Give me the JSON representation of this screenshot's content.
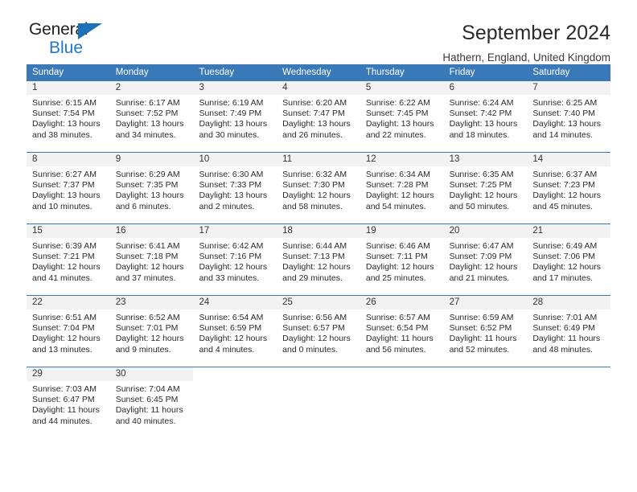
{
  "brand": {
    "name_top": "General",
    "name_bottom": "Blue",
    "triangle_color": "#1b72b8",
    "text_color": "#231f20",
    "blue_color": "#2277c8"
  },
  "header": {
    "title": "September 2024",
    "subtitle": "Hathern, England, United Kingdom"
  },
  "calendar": {
    "header_bg": "#3a79b8",
    "daynum_bg": "#f2f2f2",
    "weekdays": [
      "Sunday",
      "Monday",
      "Tuesday",
      "Wednesday",
      "Thursday",
      "Friday",
      "Saturday"
    ],
    "weeks": [
      [
        {
          "day": "1",
          "sunrise": "Sunrise: 6:15 AM",
          "sunset": "Sunset: 7:54 PM",
          "daylight1": "Daylight: 13 hours",
          "daylight2": "and 38 minutes."
        },
        {
          "day": "2",
          "sunrise": "Sunrise: 6:17 AM",
          "sunset": "Sunset: 7:52 PM",
          "daylight1": "Daylight: 13 hours",
          "daylight2": "and 34 minutes."
        },
        {
          "day": "3",
          "sunrise": "Sunrise: 6:19 AM",
          "sunset": "Sunset: 7:49 PM",
          "daylight1": "Daylight: 13 hours",
          "daylight2": "and 30 minutes."
        },
        {
          "day": "4",
          "sunrise": "Sunrise: 6:20 AM",
          "sunset": "Sunset: 7:47 PM",
          "daylight1": "Daylight: 13 hours",
          "daylight2": "and 26 minutes."
        },
        {
          "day": "5",
          "sunrise": "Sunrise: 6:22 AM",
          "sunset": "Sunset: 7:45 PM",
          "daylight1": "Daylight: 13 hours",
          "daylight2": "and 22 minutes."
        },
        {
          "day": "6",
          "sunrise": "Sunrise: 6:24 AM",
          "sunset": "Sunset: 7:42 PM",
          "daylight1": "Daylight: 13 hours",
          "daylight2": "and 18 minutes."
        },
        {
          "day": "7",
          "sunrise": "Sunrise: 6:25 AM",
          "sunset": "Sunset: 7:40 PM",
          "daylight1": "Daylight: 13 hours",
          "daylight2": "and 14 minutes."
        }
      ],
      [
        {
          "day": "8",
          "sunrise": "Sunrise: 6:27 AM",
          "sunset": "Sunset: 7:37 PM",
          "daylight1": "Daylight: 13 hours",
          "daylight2": "and 10 minutes."
        },
        {
          "day": "9",
          "sunrise": "Sunrise: 6:29 AM",
          "sunset": "Sunset: 7:35 PM",
          "daylight1": "Daylight: 13 hours",
          "daylight2": "and 6 minutes."
        },
        {
          "day": "10",
          "sunrise": "Sunrise: 6:30 AM",
          "sunset": "Sunset: 7:33 PM",
          "daylight1": "Daylight: 13 hours",
          "daylight2": "and 2 minutes."
        },
        {
          "day": "11",
          "sunrise": "Sunrise: 6:32 AM",
          "sunset": "Sunset: 7:30 PM",
          "daylight1": "Daylight: 12 hours",
          "daylight2": "and 58 minutes."
        },
        {
          "day": "12",
          "sunrise": "Sunrise: 6:34 AM",
          "sunset": "Sunset: 7:28 PM",
          "daylight1": "Daylight: 12 hours",
          "daylight2": "and 54 minutes."
        },
        {
          "day": "13",
          "sunrise": "Sunrise: 6:35 AM",
          "sunset": "Sunset: 7:25 PM",
          "daylight1": "Daylight: 12 hours",
          "daylight2": "and 50 minutes."
        },
        {
          "day": "14",
          "sunrise": "Sunrise: 6:37 AM",
          "sunset": "Sunset: 7:23 PM",
          "daylight1": "Daylight: 12 hours",
          "daylight2": "and 45 minutes."
        }
      ],
      [
        {
          "day": "15",
          "sunrise": "Sunrise: 6:39 AM",
          "sunset": "Sunset: 7:21 PM",
          "daylight1": "Daylight: 12 hours",
          "daylight2": "and 41 minutes."
        },
        {
          "day": "16",
          "sunrise": "Sunrise: 6:41 AM",
          "sunset": "Sunset: 7:18 PM",
          "daylight1": "Daylight: 12 hours",
          "daylight2": "and 37 minutes."
        },
        {
          "day": "17",
          "sunrise": "Sunrise: 6:42 AM",
          "sunset": "Sunset: 7:16 PM",
          "daylight1": "Daylight: 12 hours",
          "daylight2": "and 33 minutes."
        },
        {
          "day": "18",
          "sunrise": "Sunrise: 6:44 AM",
          "sunset": "Sunset: 7:13 PM",
          "daylight1": "Daylight: 12 hours",
          "daylight2": "and 29 minutes."
        },
        {
          "day": "19",
          "sunrise": "Sunrise: 6:46 AM",
          "sunset": "Sunset: 7:11 PM",
          "daylight1": "Daylight: 12 hours",
          "daylight2": "and 25 minutes."
        },
        {
          "day": "20",
          "sunrise": "Sunrise: 6:47 AM",
          "sunset": "Sunset: 7:09 PM",
          "daylight1": "Daylight: 12 hours",
          "daylight2": "and 21 minutes."
        },
        {
          "day": "21",
          "sunrise": "Sunrise: 6:49 AM",
          "sunset": "Sunset: 7:06 PM",
          "daylight1": "Daylight: 12 hours",
          "daylight2": "and 17 minutes."
        }
      ],
      [
        {
          "day": "22",
          "sunrise": "Sunrise: 6:51 AM",
          "sunset": "Sunset: 7:04 PM",
          "daylight1": "Daylight: 12 hours",
          "daylight2": "and 13 minutes."
        },
        {
          "day": "23",
          "sunrise": "Sunrise: 6:52 AM",
          "sunset": "Sunset: 7:01 PM",
          "daylight1": "Daylight: 12 hours",
          "daylight2": "and 9 minutes."
        },
        {
          "day": "24",
          "sunrise": "Sunrise: 6:54 AM",
          "sunset": "Sunset: 6:59 PM",
          "daylight1": "Daylight: 12 hours",
          "daylight2": "and 4 minutes."
        },
        {
          "day": "25",
          "sunrise": "Sunrise: 6:56 AM",
          "sunset": "Sunset: 6:57 PM",
          "daylight1": "Daylight: 12 hours",
          "daylight2": "and 0 minutes."
        },
        {
          "day": "26",
          "sunrise": "Sunrise: 6:57 AM",
          "sunset": "Sunset: 6:54 PM",
          "daylight1": "Daylight: 11 hours",
          "daylight2": "and 56 minutes."
        },
        {
          "day": "27",
          "sunrise": "Sunrise: 6:59 AM",
          "sunset": "Sunset: 6:52 PM",
          "daylight1": "Daylight: 11 hours",
          "daylight2": "and 52 minutes."
        },
        {
          "day": "28",
          "sunrise": "Sunrise: 7:01 AM",
          "sunset": "Sunset: 6:49 PM",
          "daylight1": "Daylight: 11 hours",
          "daylight2": "and 48 minutes."
        }
      ],
      [
        {
          "day": "29",
          "sunrise": "Sunrise: 7:03 AM",
          "sunset": "Sunset: 6:47 PM",
          "daylight1": "Daylight: 11 hours",
          "daylight2": "and 44 minutes."
        },
        {
          "day": "30",
          "sunrise": "Sunrise: 7:04 AM",
          "sunset": "Sunset: 6:45 PM",
          "daylight1": "Daylight: 11 hours",
          "daylight2": "and 40 minutes."
        },
        {
          "day": "",
          "sunrise": "",
          "sunset": "",
          "daylight1": "",
          "daylight2": ""
        },
        {
          "day": "",
          "sunrise": "",
          "sunset": "",
          "daylight1": "",
          "daylight2": ""
        },
        {
          "day": "",
          "sunrise": "",
          "sunset": "",
          "daylight1": "",
          "daylight2": ""
        },
        {
          "day": "",
          "sunrise": "",
          "sunset": "",
          "daylight1": "",
          "daylight2": ""
        },
        {
          "day": "",
          "sunrise": "",
          "sunset": "",
          "daylight1": "",
          "daylight2": ""
        }
      ]
    ]
  }
}
